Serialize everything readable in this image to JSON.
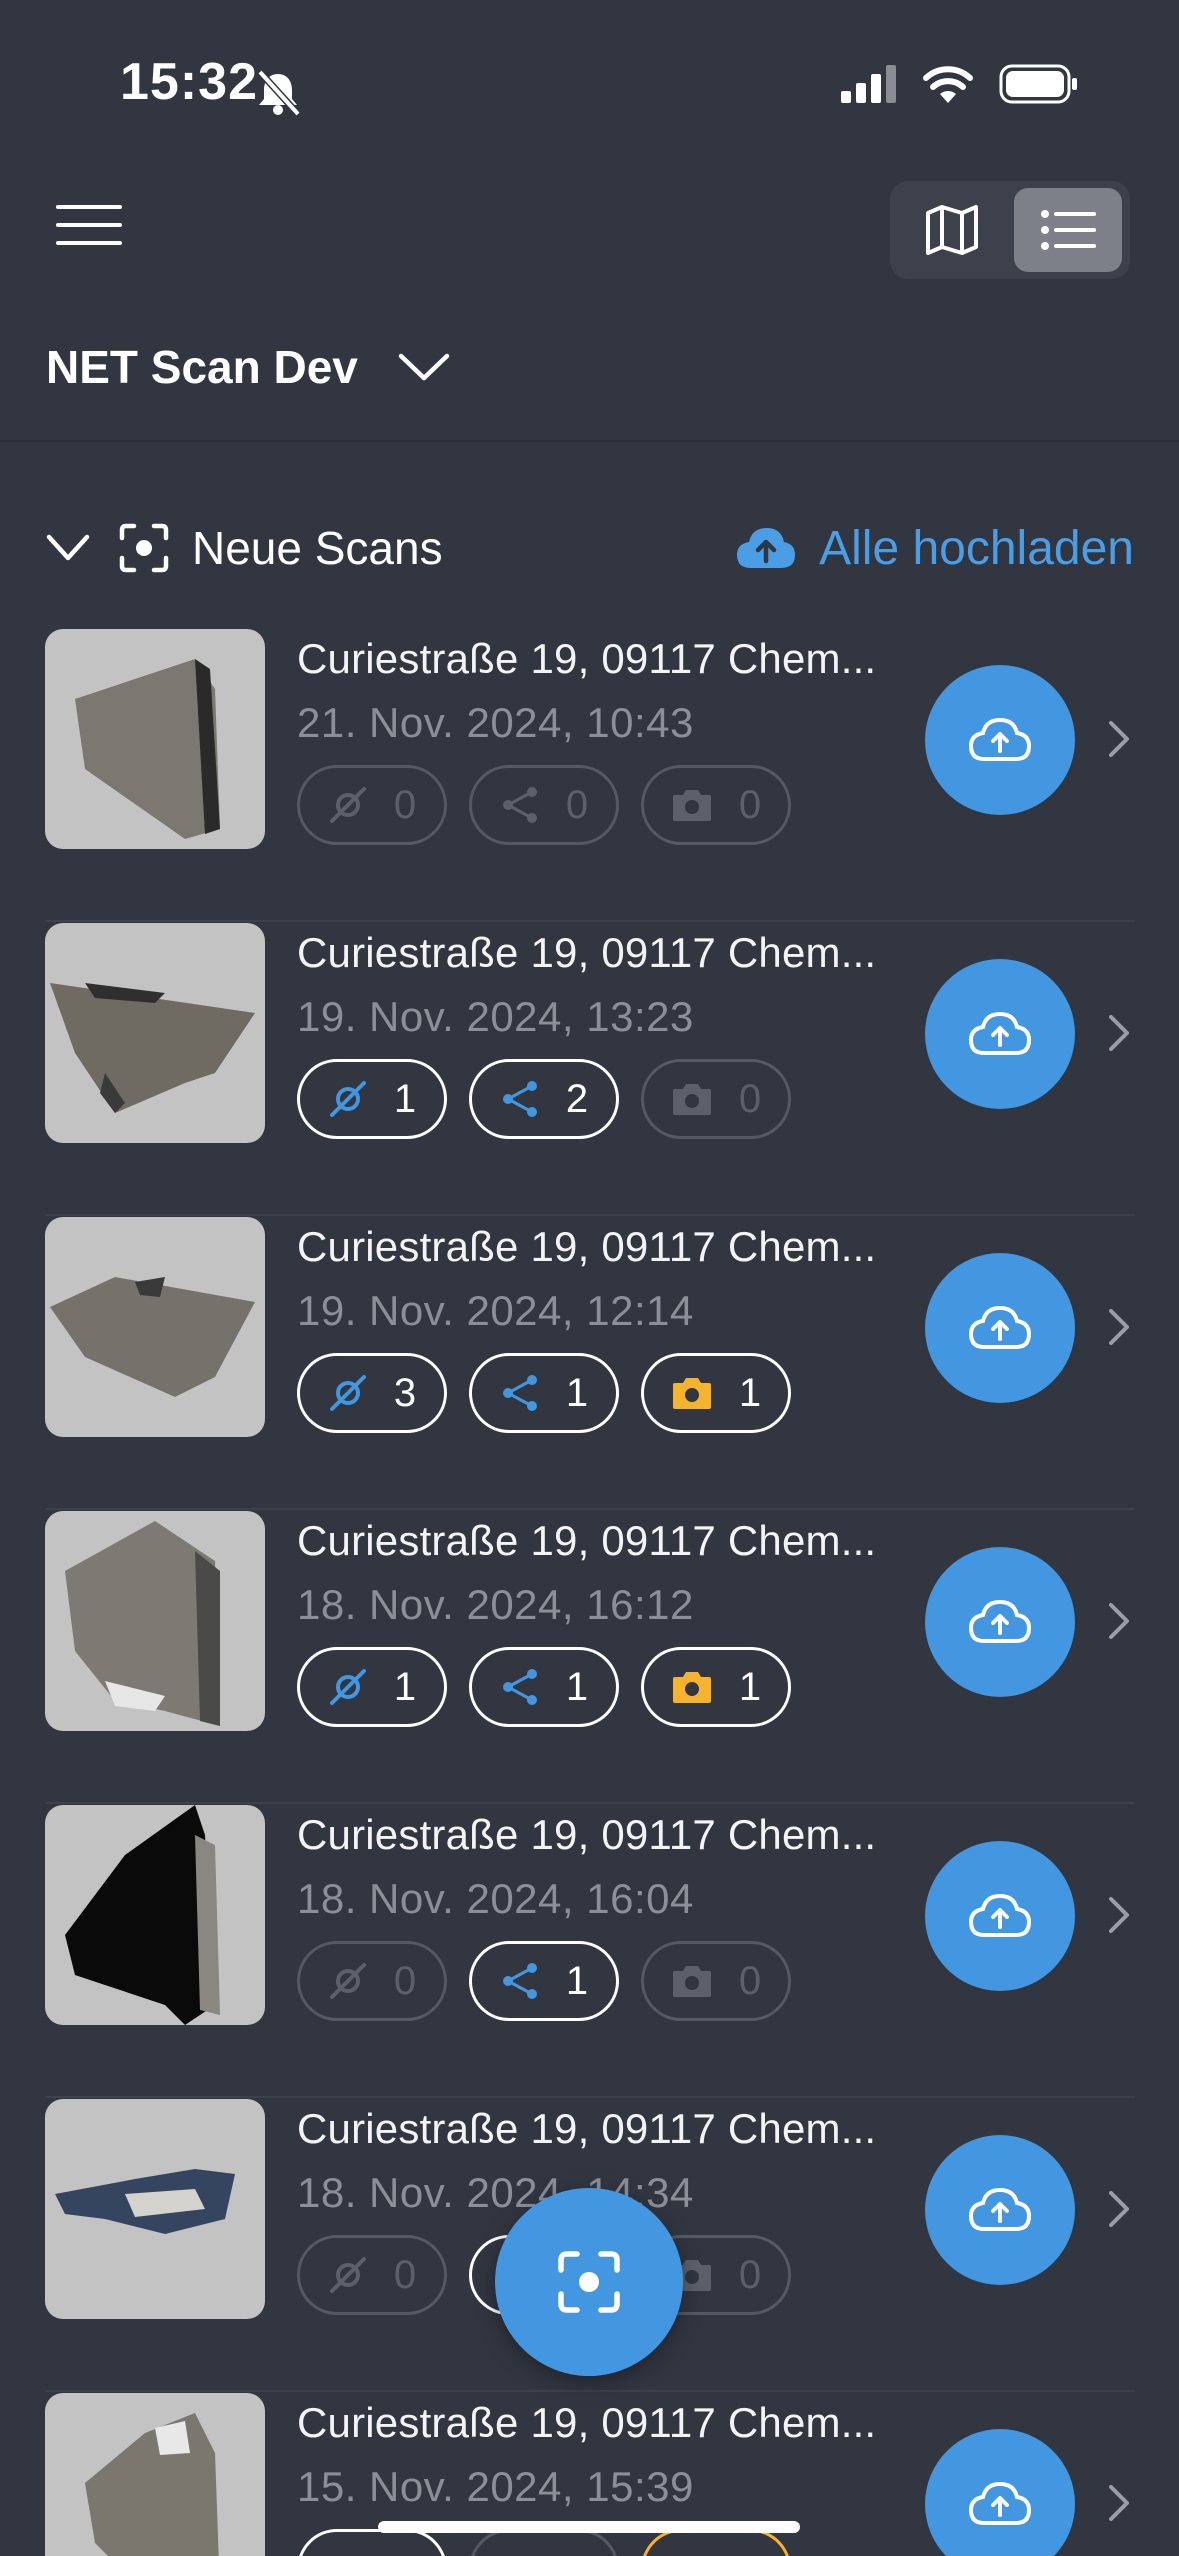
{
  "status_bar": {
    "time": "15:32"
  },
  "header": {
    "workspace_name": "NET Scan Dev",
    "view_modes": [
      "map-view",
      "list-view"
    ],
    "active_view": "list-view"
  },
  "section": {
    "title": "Neue Scans",
    "upload_all_label": "Alle hochladen"
  },
  "colors": {
    "accent": "#4396e0",
    "link": "#4a9ee6",
    "camera": "#f6b32e",
    "background": "#323641"
  },
  "scans": [
    {
      "title": "Curiestraße 19, 09117 Chem...",
      "date": "21. Nov. 2024, 10:43",
      "sensors": "0",
      "connections": "0",
      "photos": "0"
    },
    {
      "title": "Curiestraße 19, 09117 Chem...",
      "date": "19. Nov. 2024, 13:23",
      "sensors": "1",
      "connections": "2",
      "photos": "0"
    },
    {
      "title": "Curiestraße 19, 09117 Chem...",
      "date": "19. Nov. 2024, 12:14",
      "sensors": "3",
      "connections": "1",
      "photos": "1"
    },
    {
      "title": "Curiestraße 19, 09117 Chem...",
      "date": "18. Nov. 2024, 16:12",
      "sensors": "1",
      "connections": "1",
      "photos": "1"
    },
    {
      "title": "Curiestraße 19, 09117 Chem...",
      "date": "18. Nov. 2024, 16:04",
      "sensors": "0",
      "connections": "1",
      "photos": "0"
    },
    {
      "title": "Curiestraße 19, 09117 Chem...",
      "date": "18. Nov. 2024, 14:34",
      "sensors": "0",
      "connections": "",
      "photos": "0"
    },
    {
      "title": "Curiestraße 19, 09117 Chem...",
      "date": "15. Nov. 2024, 15:39",
      "sensors": "",
      "connections": "",
      "photos": ""
    }
  ]
}
